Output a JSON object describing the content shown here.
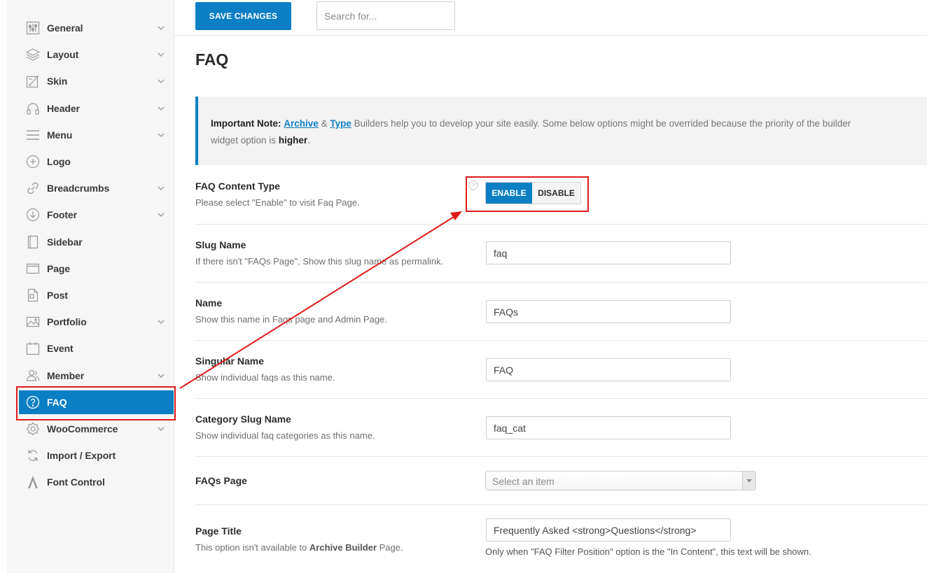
{
  "sidebar": {
    "items": [
      {
        "label": "General",
        "icon": "sliders-icon",
        "has_chevron": true
      },
      {
        "label": "Layout",
        "icon": "layers-icon",
        "has_chevron": true
      },
      {
        "label": "Skin",
        "icon": "paint-icon",
        "has_chevron": true
      },
      {
        "label": "Header",
        "icon": "headphones-icon",
        "has_chevron": true
      },
      {
        "label": "Menu",
        "icon": "hamburger-icon",
        "has_chevron": true
      },
      {
        "label": "Logo",
        "icon": "plus-circle-icon",
        "has_chevron": false
      },
      {
        "label": "Breadcrumbs",
        "icon": "link-icon",
        "has_chevron": true
      },
      {
        "label": "Footer",
        "icon": "arrow-down-circle-icon",
        "has_chevron": true
      },
      {
        "label": "Sidebar",
        "icon": "sidebar-icon",
        "has_chevron": false
      },
      {
        "label": "Page",
        "icon": "browser-icon",
        "has_chevron": false
      },
      {
        "label": "Post",
        "icon": "document-icon",
        "has_chevron": false
      },
      {
        "label": "Portfolio",
        "icon": "image-icon",
        "has_chevron": true
      },
      {
        "label": "Event",
        "icon": "calendar-icon",
        "has_chevron": false
      },
      {
        "label": "Member",
        "icon": "users-icon",
        "has_chevron": true
      },
      {
        "label": "FAQ",
        "icon": "question-circle-icon",
        "has_chevron": false,
        "active": true
      },
      {
        "label": "WooCommerce",
        "icon": "woo-icon",
        "has_chevron": true
      },
      {
        "label": "Import / Export",
        "icon": "refresh-icon",
        "has_chevron": false
      },
      {
        "label": "Font Control",
        "icon": "font-icon",
        "has_chevron": false
      }
    ]
  },
  "toolbar": {
    "save_label": "SAVE CHANGES",
    "search_placeholder": "Search for..."
  },
  "main": {
    "title": "FAQ",
    "notice": {
      "prefix": "Important Note:",
      "link1": "Archive",
      "amp": "&",
      "link2": "Type",
      "text": "Builders help you to develop your site easily. Some below options might be overrided because the priority of the builder widget option is",
      "emph": "higher",
      "suffix": "."
    },
    "rows": {
      "content_type": {
        "title": "FAQ Content Type",
        "desc": "Please select \"Enable\" to visit Faq Page.",
        "enable": "ENABLE",
        "disable": "DISABLE",
        "value": "ENABLE"
      },
      "slug": {
        "title": "Slug Name",
        "desc": "If there isn't \"FAQs Page\", Show this slug name as permalink.",
        "value": "faq"
      },
      "name": {
        "title": "Name",
        "desc": "Show this name in Faqs page and Admin Page.",
        "value": "FAQs"
      },
      "singular": {
        "title": "Singular Name",
        "desc": "Show individual faqs as this name.",
        "value": "FAQ"
      },
      "category_slug": {
        "title": "Category Slug Name",
        "desc": "Show individual faq categories as this name.",
        "value": "faq_cat"
      },
      "faqs_page": {
        "title": "FAQs Page",
        "placeholder": "Select an item"
      },
      "page_title": {
        "title": "Page Title",
        "desc_prefix": "This option isn't available to",
        "desc_bold": "Archive Builder",
        "desc_suffix": "Page.",
        "value": "Frequently Asked <strong>Questions</strong>",
        "note": "Only when \"FAQ Filter Position\" option is the \"In Content\", this text will be shown."
      }
    }
  },
  "colors": {
    "accent": "#0c7fc4",
    "annotation": "#e01b1b"
  }
}
